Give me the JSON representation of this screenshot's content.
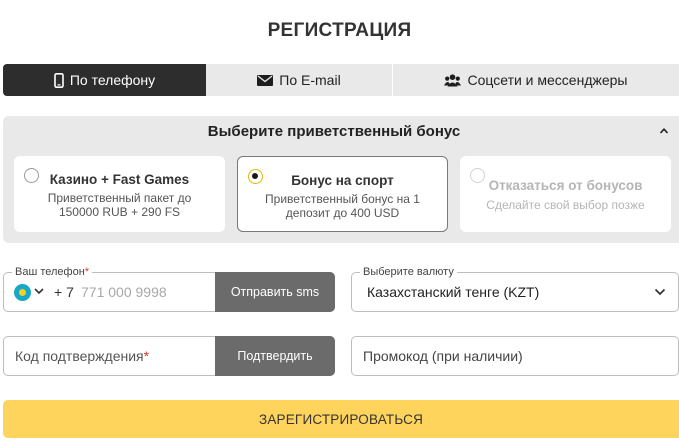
{
  "title": "РЕГИСТРАЦИЯ",
  "tabs": [
    {
      "label": "По телефону",
      "icon": "phone-icon",
      "active": true
    },
    {
      "label": "По E-mail",
      "icon": "envelope-icon",
      "active": false
    },
    {
      "label": "Соцсети и мессенджеры",
      "icon": "users-icon",
      "active": false
    }
  ],
  "bonus": {
    "heading": "Выберите приветственный бонус",
    "options": [
      {
        "name": "Казино + Fast Games",
        "desc_line1": "Приветственный пакет до",
        "desc_line2": "150000 RUB + 290 FS",
        "selected": false
      },
      {
        "name": "Бонус на спорт",
        "desc_line1": "Приветственный бонус на 1",
        "desc_line2": "депозит до 400 USD",
        "selected": true
      },
      {
        "name": "Отказаться от бонусов",
        "desc_line1": "Сделайте свой выбор позже",
        "desc_line2": "",
        "selected": false
      }
    ]
  },
  "phone": {
    "label": "Ваш телефон",
    "required_mark": "*",
    "prefix": "+ 7",
    "placeholder": "771 000 9998",
    "send_sms": "Отправить sms"
  },
  "currency": {
    "label": "Выберите валюту",
    "value": "Казахстанский тенге (KZT)"
  },
  "confirm": {
    "placeholder": "Код подтверждения",
    "required_mark": "*",
    "button": "Подтвердить"
  },
  "promo": {
    "placeholder": "Промокод (при наличии)"
  },
  "submit": "ЗАРЕГИСТРИРОВАТЬСЯ",
  "colors": {
    "accent_yellow": "#ffd45c",
    "tab_active": "#2d2d2d",
    "panel_bg": "#e9e9e9",
    "button_gray": "#6b6b6b",
    "required_red": "#d53a2a"
  }
}
